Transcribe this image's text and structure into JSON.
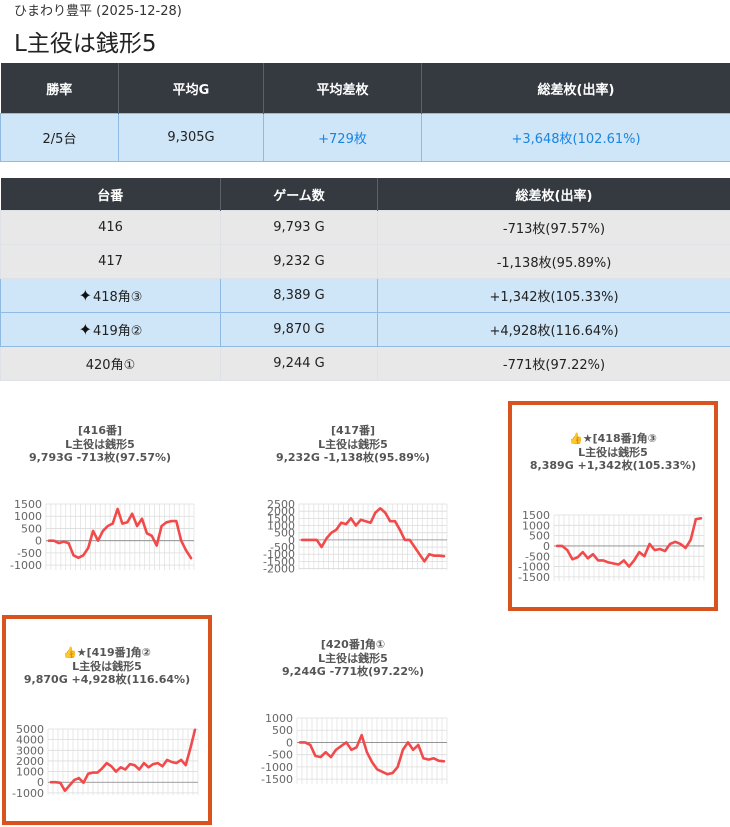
{
  "header": {
    "subtitle": "ひまわり豊平 (2025-12-28)",
    "title": "L主役は銭形5"
  },
  "summary": {
    "headers": [
      "勝率",
      "平均G",
      "平均差枚",
      "総差枚(出率)"
    ],
    "win_rate": "2/5台",
    "avg_games": "9,305G",
    "avg_diff": "+729枚",
    "total_diff": "+3,648枚(102.61%)"
  },
  "machines": {
    "headers": [
      "台番",
      "ゲーム数",
      "総差枚(出率)"
    ],
    "rows": [
      {
        "machine": "416",
        "games": "9,793 G",
        "diff": "-713枚(97.57%)",
        "highlight": false
      },
      {
        "machine": "417",
        "games": "9,232 G",
        "diff": "-1,138枚(95.89%)",
        "highlight": false
      },
      {
        "machine": "418角③",
        "games": "8,389 G",
        "diff": "+1,342枚(105.33%)",
        "highlight": true
      },
      {
        "machine": "419角②",
        "games": "9,870 G",
        "diff": "+4,928枚(116.64%)",
        "highlight": true
      },
      {
        "machine": "420角①",
        "games": "9,244 G",
        "diff": "-771枚(97.22%)",
        "highlight": false
      }
    ]
  },
  "colors": {
    "line": "#f24a4a",
    "highlight_border": "#d9531e",
    "header_bg": "#343a40",
    "highlight_row": "#cfe5f8",
    "positive_text": "#1a85e0"
  },
  "cards": [
    {
      "line1": "[416番]",
      "line2": "L主役は銭形5",
      "line3": "9,793G -713枚(97.57%)",
      "chart_data": {
        "type": "line",
        "y_ticks": [
          1500,
          1000,
          500,
          0,
          -500,
          -1000
        ],
        "ylim": [
          -1200,
          1500
        ],
        "values": [
          0,
          0,
          -100,
          -40,
          -100,
          -600,
          -700,
          -600,
          -300,
          400,
          0,
          400,
          600,
          700,
          1300,
          700,
          750,
          1100,
          600,
          900,
          300,
          200,
          -200,
          600,
          750,
          800,
          800,
          0,
          -400,
          -713
        ]
      }
    },
    {
      "line1": "[417番]",
      "line2": "L主役は銭形5",
      "line3": "9,232G -1,138枚(95.89%)",
      "chart_data": {
        "type": "line",
        "y_ticks": [
          2500,
          2000,
          1500,
          1000,
          500,
          0,
          -500,
          -1000,
          -1500,
          -2000
        ],
        "ylim": [
          -2100,
          2500
        ],
        "values": [
          0,
          0,
          0,
          0,
          -500,
          100,
          500,
          700,
          1200,
          1100,
          1500,
          1000,
          1400,
          1300,
          1200,
          1900,
          2200,
          1900,
          1300,
          1300,
          700,
          0,
          0,
          -500,
          -1000,
          -1500,
          -1000,
          -1100,
          -1100,
          -1138
        ]
      }
    },
    {
      "line1": "👍★[418番]角③",
      "line2": "L主役は銭形5",
      "line3": "8,389G +1,342枚(105.33%)",
      "chart_data": {
        "type": "line",
        "y_ticks": [
          1500,
          1000,
          500,
          0,
          -500,
          -1000,
          -1500
        ],
        "ylim": [
          -1700,
          1500
        ],
        "values": [
          0,
          0,
          -200,
          -650,
          -550,
          -300,
          -600,
          -400,
          -700,
          -700,
          -800,
          -850,
          -900,
          -700,
          -1000,
          -700,
          -300,
          -500,
          100,
          -200,
          -150,
          -250,
          100,
          200,
          100,
          -100,
          300,
          1300,
          1342
        ]
      }
    },
    {
      "line1": "👍★[419番]角②",
      "line2": "L主役は銭形5",
      "line3": "9,870G +4,928枚(116.64%)",
      "chart_data": {
        "type": "line",
        "y_ticks": [
          5000,
          4000,
          3000,
          2000,
          1000,
          0,
          -1000
        ],
        "ylim": [
          -1200,
          5000
        ],
        "values": [
          0,
          0,
          -50,
          -800,
          -300,
          200,
          400,
          -50,
          800,
          900,
          900,
          1300,
          1800,
          1500,
          1000,
          1400,
          1200,
          1700,
          1600,
          1200,
          1800,
          1400,
          1700,
          1800,
          1500,
          2100,
          1900,
          1800,
          2100,
          1600,
          3200,
          4928
        ]
      }
    },
    {
      "line1": "[420番]角①",
      "line2": "L主役は銭形5",
      "line3": "9,244G -771枚(97.22%)",
      "chart_data": {
        "type": "line",
        "y_ticks": [
          1000,
          500,
          0,
          -500,
          -1000,
          -1500
        ],
        "ylim": [
          -1700,
          1000
        ],
        "values": [
          0,
          0,
          -100,
          -550,
          -600,
          -400,
          -600,
          -300,
          -150,
          0,
          -300,
          -200,
          300,
          -400,
          -800,
          -1100,
          -1200,
          -1300,
          -1250,
          -1000,
          -300,
          0,
          -300,
          -100,
          -650,
          -700,
          -650,
          -750,
          -771
        ]
      }
    }
  ]
}
